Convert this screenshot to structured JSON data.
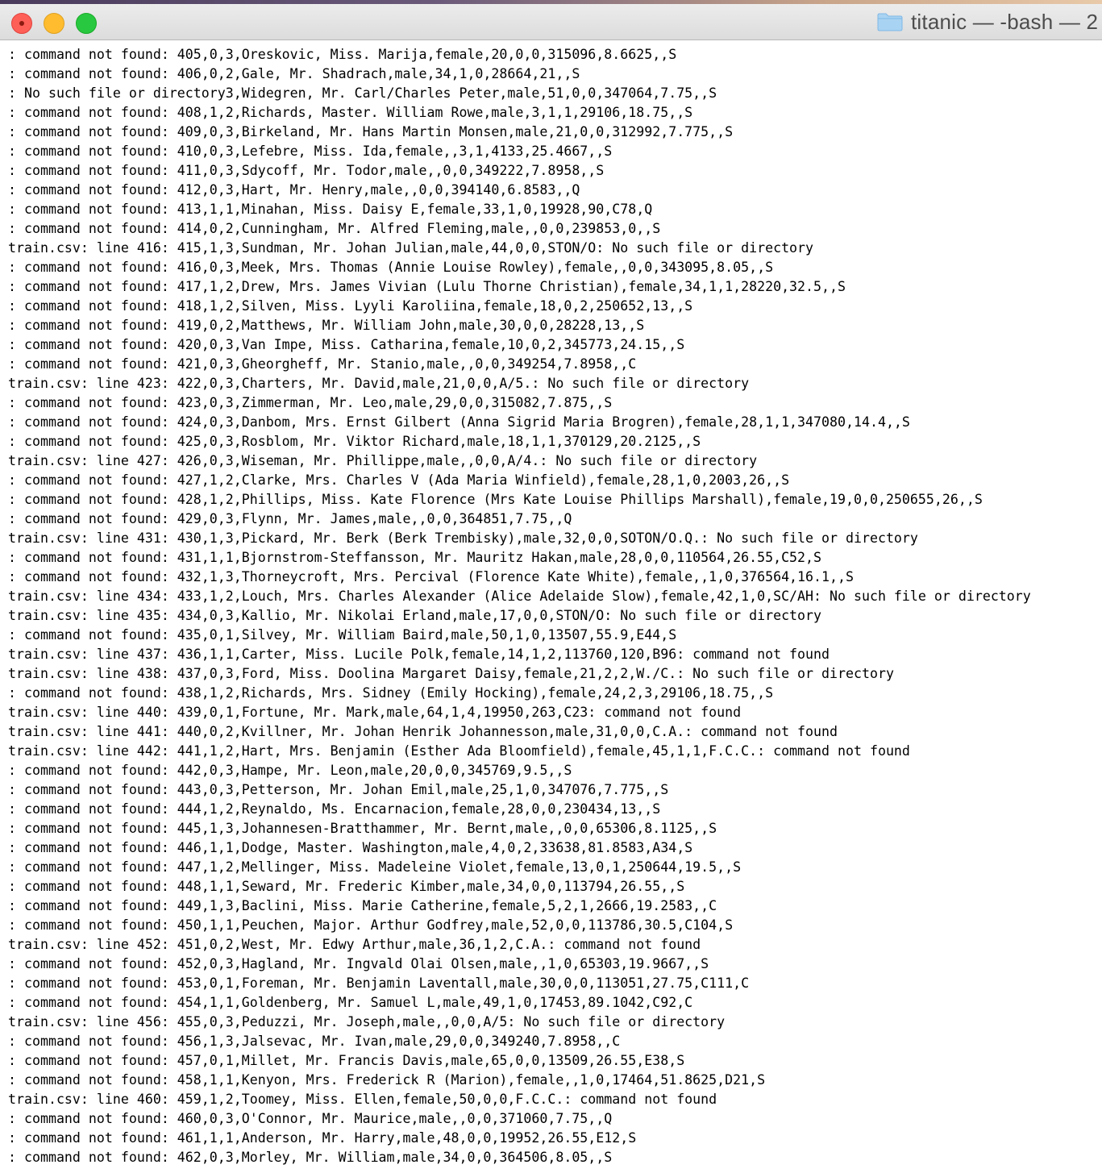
{
  "window": {
    "title": "titanic — -bash — 2"
  },
  "terminal": {
    "lines": [
      ": command not found: 405,0,3,Oreskovic, Miss. Marija,female,20,0,0,315096,8.6625,,S",
      ": command not found: 406,0,2,Gale, Mr. Shadrach,male,34,1,0,28664,21,,S",
      ": No such file or directory3,Widegren, Mr. Carl/Charles Peter,male,51,0,0,347064,7.75,,S",
      ": command not found: 408,1,2,Richards, Master. William Rowe,male,3,1,1,29106,18.75,,S",
      ": command not found: 409,0,3,Birkeland, Mr. Hans Martin Monsen,male,21,0,0,312992,7.775,,S",
      ": command not found: 410,0,3,Lefebre, Miss. Ida,female,,3,1,4133,25.4667,,S",
      ": command not found: 411,0,3,Sdycoff, Mr. Todor,male,,0,0,349222,7.8958,,S",
      ": command not found: 412,0,3,Hart, Mr. Henry,male,,0,0,394140,6.8583,,Q",
      ": command not found: 413,1,1,Minahan, Miss. Daisy E,female,33,1,0,19928,90,C78,Q",
      ": command not found: 414,0,2,Cunningham, Mr. Alfred Fleming,male,,0,0,239853,0,,S",
      "train.csv: line 416: 415,1,3,Sundman, Mr. Johan Julian,male,44,0,0,STON/O: No such file or directory",
      ": command not found: 416,0,3,Meek, Mrs. Thomas (Annie Louise Rowley),female,,0,0,343095,8.05,,S",
      ": command not found: 417,1,2,Drew, Mrs. James Vivian (Lulu Thorne Christian),female,34,1,1,28220,32.5,,S",
      ": command not found: 418,1,2,Silven, Miss. Lyyli Karoliina,female,18,0,2,250652,13,,S",
      ": command not found: 419,0,2,Matthews, Mr. William John,male,30,0,0,28228,13,,S",
      ": command not found: 420,0,3,Van Impe, Miss. Catharina,female,10,0,2,345773,24.15,,S",
      ": command not found: 421,0,3,Gheorgheff, Mr. Stanio,male,,0,0,349254,7.8958,,C",
      "train.csv: line 423: 422,0,3,Charters, Mr. David,male,21,0,0,A/5.: No such file or directory",
      ": command not found: 423,0,3,Zimmerman, Mr. Leo,male,29,0,0,315082,7.875,,S",
      ": command not found: 424,0,3,Danbom, Mrs. Ernst Gilbert (Anna Sigrid Maria Brogren),female,28,1,1,347080,14.4,,S",
      ": command not found: 425,0,3,Rosblom, Mr. Viktor Richard,male,18,1,1,370129,20.2125,,S",
      "train.csv: line 427: 426,0,3,Wiseman, Mr. Phillippe,male,,0,0,A/4.: No such file or directory",
      ": command not found: 427,1,2,Clarke, Mrs. Charles V (Ada Maria Winfield),female,28,1,0,2003,26,,S",
      ": command not found: 428,1,2,Phillips, Miss. Kate Florence (Mrs Kate Louise Phillips Marshall),female,19,0,0,250655,26,,S",
      ": command not found: 429,0,3,Flynn, Mr. James,male,,0,0,364851,7.75,,Q",
      "train.csv: line 431: 430,1,3,Pickard, Mr. Berk (Berk Trembisky),male,32,0,0,SOTON/O.Q.: No such file or directory",
      ": command not found: 431,1,1,Bjornstrom-Steffansson, Mr. Mauritz Hakan,male,28,0,0,110564,26.55,C52,S",
      ": command not found: 432,1,3,Thorneycroft, Mrs. Percival (Florence Kate White),female,,1,0,376564,16.1,,S",
      "train.csv: line 434: 433,1,2,Louch, Mrs. Charles Alexander (Alice Adelaide Slow),female,42,1,0,SC/AH: No such file or directory",
      "train.csv: line 435: 434,0,3,Kallio, Mr. Nikolai Erland,male,17,0,0,STON/O: No such file or directory",
      ": command not found: 435,0,1,Silvey, Mr. William Baird,male,50,1,0,13507,55.9,E44,S",
      "train.csv: line 437: 436,1,1,Carter, Miss. Lucile Polk,female,14,1,2,113760,120,B96: command not found",
      "train.csv: line 438: 437,0,3,Ford, Miss. Doolina Margaret Daisy,female,21,2,2,W./C.: No such file or directory",
      ": command not found: 438,1,2,Richards, Mrs. Sidney (Emily Hocking),female,24,2,3,29106,18.75,,S",
      "train.csv: line 440: 439,0,1,Fortune, Mr. Mark,male,64,1,4,19950,263,C23: command not found",
      "train.csv: line 441: 440,0,2,Kvillner, Mr. Johan Henrik Johannesson,male,31,0,0,C.A.: command not found",
      "train.csv: line 442: 441,1,2,Hart, Mrs. Benjamin (Esther Ada Bloomfield),female,45,1,1,F.C.C.: command not found",
      ": command not found: 442,0,3,Hampe, Mr. Leon,male,20,0,0,345769,9.5,,S",
      ": command not found: 443,0,3,Petterson, Mr. Johan Emil,male,25,1,0,347076,7.775,,S",
      ": command not found: 444,1,2,Reynaldo, Ms. Encarnacion,female,28,0,0,230434,13,,S",
      ": command not found: 445,1,3,Johannesen-Bratthammer, Mr. Bernt,male,,0,0,65306,8.1125,,S",
      ": command not found: 446,1,1,Dodge, Master. Washington,male,4,0,2,33638,81.8583,A34,S",
      ": command not found: 447,1,2,Mellinger, Miss. Madeleine Violet,female,13,0,1,250644,19.5,,S",
      ": command not found: 448,1,1,Seward, Mr. Frederic Kimber,male,34,0,0,113794,26.55,,S",
      ": command not found: 449,1,3,Baclini, Miss. Marie Catherine,female,5,2,1,2666,19.2583,,C",
      ": command not found: 450,1,1,Peuchen, Major. Arthur Godfrey,male,52,0,0,113786,30.5,C104,S",
      "train.csv: line 452: 451,0,2,West, Mr. Edwy Arthur,male,36,1,2,C.A.: command not found",
      ": command not found: 452,0,3,Hagland, Mr. Ingvald Olai Olsen,male,,1,0,65303,19.9667,,S",
      ": command not found: 453,0,1,Foreman, Mr. Benjamin Laventall,male,30,0,0,113051,27.75,C111,C",
      ": command not found: 454,1,1,Goldenberg, Mr. Samuel L,male,49,1,0,17453,89.1042,C92,C",
      "train.csv: line 456: 455,0,3,Peduzzi, Mr. Joseph,male,,0,0,A/5: No such file or directory",
      ": command not found: 456,1,3,Jalsevac, Mr. Ivan,male,29,0,0,349240,7.8958,,C",
      ": command not found: 457,0,1,Millet, Mr. Francis Davis,male,65,0,0,13509,26.55,E38,S",
      ": command not found: 458,1,1,Kenyon, Mrs. Frederick R (Marion),female,,1,0,17464,51.8625,D21,S",
      "train.csv: line 460: 459,1,2,Toomey, Miss. Ellen,female,50,0,0,F.C.C.: command not found",
      ": command not found: 460,0,3,O'Connor, Mr. Maurice,male,,0,0,371060,7.75,,Q",
      ": command not found: 461,1,1,Anderson, Mr. Harry,male,48,0,0,19952,26.55,E12,S",
      ": command not found: 462,0,3,Morley, Mr. William,male,34,0,0,364506,8.05,,S"
    ]
  },
  "colors": {
    "close": "#fe5f57",
    "minimize": "#febc2e",
    "zoom": "#28c840",
    "folder": "#7fb8e6"
  }
}
